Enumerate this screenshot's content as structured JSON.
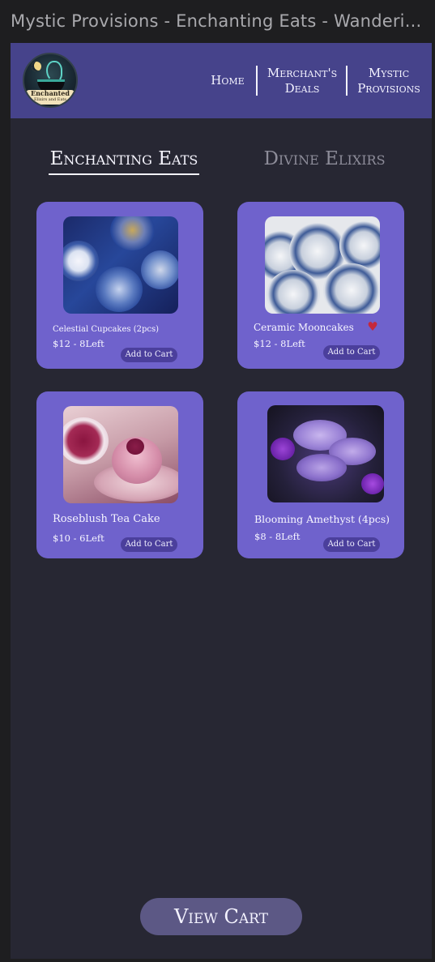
{
  "window": {
    "title": "Mystic Provisions - Enchanting Eats - Wanderi..."
  },
  "logo": {
    "line1": "Enchanted",
    "line2": "Elixirs and Eats"
  },
  "nav": {
    "home": "Home",
    "merchants_deals": "Merchant's Deals",
    "mystic_provisions": "Mystic Provisions"
  },
  "tabs": [
    {
      "label": "Enchanting Eats",
      "active": true
    },
    {
      "label": "Divine Elixirs",
      "active": false
    }
  ],
  "products": [
    {
      "name": "Celestial Cupcakes (2pcs)",
      "price": "$12  -  8Left",
      "button": "Add to Cart",
      "image_icon": "cupcakes-image",
      "favorited": false
    },
    {
      "name": "Ceramic Mooncakes",
      "price": "$12  -  8Left",
      "button": "Add to Cart",
      "image_icon": "mooncakes-image",
      "favorited": true,
      "heart": "♥"
    },
    {
      "name": "Roseblush Tea Cake",
      "price": "$10  -  6Left",
      "button": "Add to Cart",
      "image_icon": "tea-cake-image",
      "favorited": false
    },
    {
      "name": "Blooming Amethyst (4pcs)",
      "price": "$8  -  8Left",
      "button": "Add to Cart",
      "image_icon": "amethyst-cookies-image",
      "favorited": false
    }
  ],
  "view_cart": "View Cart",
  "colors": {
    "navbar": "#46438b",
    "background": "#272733",
    "card": "#6f62cc",
    "button": "#4b3f9c",
    "heart": "#c4283c",
    "view_cart": "#5c5885"
  }
}
